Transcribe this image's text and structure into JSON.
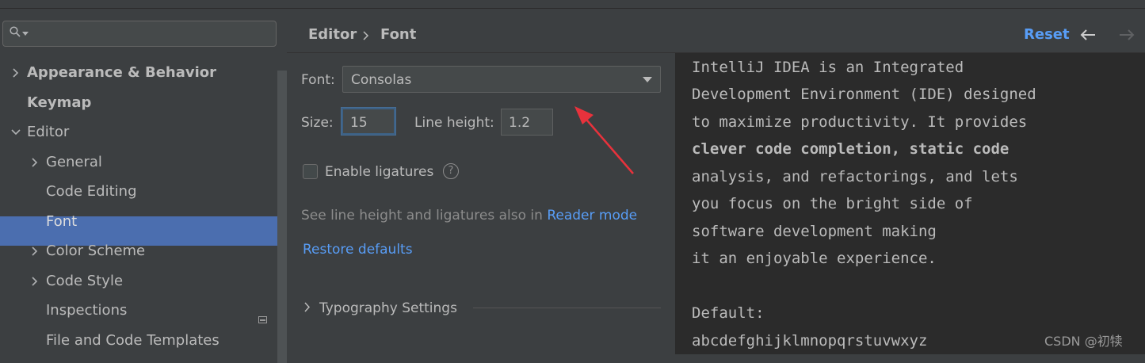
{
  "sidebar": {
    "search": {
      "placeholder": ""
    },
    "items": [
      {
        "label": "Appearance & Behavior"
      },
      {
        "label": "Keymap"
      },
      {
        "label": "Editor"
      },
      {
        "label": "General"
      },
      {
        "label": "Code Editing"
      },
      {
        "label": "Font"
      },
      {
        "label": "Color Scheme"
      },
      {
        "label": "Code Style"
      },
      {
        "label": "Inspections"
      },
      {
        "label": "File and Code Templates"
      }
    ]
  },
  "header": {
    "breadcrumb": [
      "Editor",
      "Font"
    ],
    "reset_label": "Reset",
    "back_icon": "arrow-left-icon",
    "forward_icon": "arrow-right-icon"
  },
  "form": {
    "font_label": "Font:",
    "font_value": "Consolas",
    "size_label": "Size:",
    "size_value": "15",
    "line_height_label": "Line height:",
    "line_height_value": "1.2",
    "ligatures_label": "Enable ligatures",
    "ligatures_checked": false,
    "hint_text": "See line height and ligatures also in",
    "reader_mode_link": "Reader mode",
    "restore_defaults": "Restore defaults",
    "typography_settings": "Typography Settings"
  },
  "preview": {
    "lines": [
      "IntelliJ IDEA is an Integrated",
      "Development Environment (IDE) designed",
      "to maximize productivity. It provides",
      "clever code completion, static code",
      "analysis, and refactorings, and lets",
      "you focus on the bright side of",
      "software development making",
      "it an enjoyable experience.",
      "",
      "Default:",
      "abcdefghijklmnopqrstuvwxyz"
    ]
  },
  "watermark": "CSDN @初犊",
  "colors": {
    "accent": "#589df6",
    "selection": "#4b6eaf",
    "annotation_arrow": "#e8323c"
  }
}
